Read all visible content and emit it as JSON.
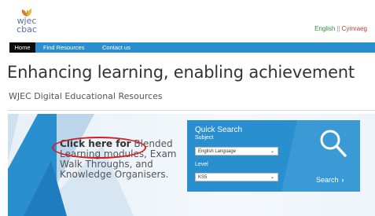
{
  "header": {
    "logo_text_line1": "wjec",
    "logo_text_line2": "cbac",
    "lang_english": "English",
    "lang_separator": "||",
    "lang_welsh": "Cymraeg"
  },
  "nav": {
    "items": [
      "Home",
      "Find Resources",
      "Contact us"
    ],
    "active_index": 0
  },
  "hero": {
    "headline": "Enhancing learning, enabling achievement",
    "subheadline": "WJEC Digital Educational Resources"
  },
  "promo": {
    "bold_text": "Click here for",
    "rest_text": " Blended Learning modules, Exam Walk Throughs, and Knowledge Organisers."
  },
  "quick_search": {
    "title": "Quick Search",
    "subject_label": "Subject",
    "subject_value": "English Language",
    "level_label": "Level",
    "level_value": "KS5",
    "search_label": "Search",
    "search_arrow": "›"
  },
  "colors": {
    "nav_blue": "#2a8fcf",
    "annotation_red": "#d32121",
    "english_green": "#2e8b3a",
    "welsh_red": "#c0392b"
  }
}
